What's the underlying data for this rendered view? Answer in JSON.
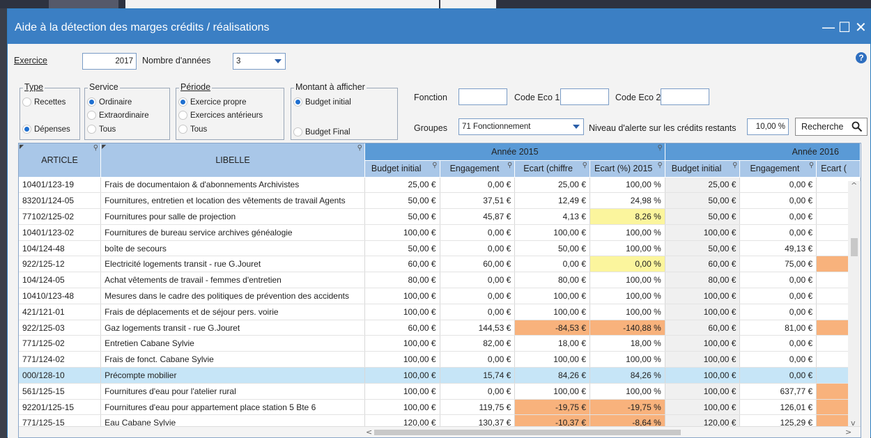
{
  "window": {
    "title": "Aide à la détection des marges crédits / réalisations",
    "minimize": "—",
    "maximize": "☐",
    "close": "✕"
  },
  "filters": {
    "exercice_label": "Exercice",
    "exercice_value": "2017",
    "nombre_annees_label": "Nombre d'années",
    "nombre_annees_value": "3",
    "type_label": "Type",
    "type_options": [
      "Recettes",
      "Dépenses"
    ],
    "type_selected": "Dépenses",
    "service_label": "Service",
    "service_options": [
      "Ordinaire",
      "Extraordinaire",
      "Tous"
    ],
    "service_selected": "Ordinaire",
    "periode_label": "Période",
    "periode_options": [
      "Exercice propre",
      "Exercices antérieurs",
      "Tous"
    ],
    "periode_selected": "Exercice propre",
    "montant_label": "Montant à afficher",
    "montant_options": [
      "Budget initial",
      "Budget Final"
    ],
    "montant_selected": "Budget initial",
    "fonction_label": "Fonction",
    "fonction_value": "",
    "code_eco1_label": "Code Eco 1",
    "code_eco1_value": "",
    "code_eco2_label": "Code Eco 2",
    "code_eco2_value": "",
    "groupes_label": "Groupes",
    "groupes_value": "71 Fonctionnement",
    "alerte_label": "Niveau d'alerte sur les crédits restants",
    "alerte_value": "10,00 %",
    "search_button": "Recherche",
    "help_icon": "?"
  },
  "table": {
    "col_article": "ARTICLE",
    "col_libelle": "LIBELLE",
    "year1": "Année 2015",
    "year2": "Année 2016",
    "sub_budget": "Budget initial",
    "sub_engagement": "Engagement",
    "sub_ecart_chiffre": "Ecart (chiffre",
    "sub_ecart_pct": "Ecart (%) 2015",
    "sub_ecart2": "Ecart (",
    "rows": [
      {
        "article": "10401/123-19",
        "libelle": "Frais de documentaion & d'abonnements Archivistes",
        "b15": "25,00 €",
        "e15": "0,00 €",
        "ec15": "25,00 €",
        "ep15": "100,00 %",
        "b16": "25,00 €",
        "e16": "0,00 €",
        "hl": "",
        "hl2": ""
      },
      {
        "article": "83201/124-05",
        "libelle": "Fournitures, entretien et location des vêtements de travail Agents",
        "b15": "50,00 €",
        "e15": "37,51 €",
        "ec15": "12,49 €",
        "ep15": "24,98 %",
        "b16": "50,00 €",
        "e16": "0,00 €",
        "hl": "",
        "hl2": ""
      },
      {
        "article": "77102/125-02",
        "libelle": "Fournitures pour salle de projection",
        "b15": "50,00 €",
        "e15": "45,87 €",
        "ec15": "4,13 €",
        "ep15": "8,26 %",
        "b16": "50,00 €",
        "e16": "0,00 €",
        "hl": "yellow",
        "hl2": ""
      },
      {
        "article": "10401/123-02",
        "libelle": "Fournitures de bureau service archives généalogie",
        "b15": "100,00 €",
        "e15": "0,00 €",
        "ec15": "100,00 €",
        "ep15": "100,00 %",
        "b16": "100,00 €",
        "e16": "0,00 €",
        "hl": "",
        "hl2": ""
      },
      {
        "article": "104/124-48",
        "libelle": "boîte de secours",
        "b15": "50,00 €",
        "e15": "0,00 €",
        "ec15": "50,00 €",
        "ep15": "100,00 %",
        "b16": "50,00 €",
        "e16": "49,13 €",
        "hl": "",
        "hl2": ""
      },
      {
        "article": "922/125-12",
        "libelle": "Electricité logements transit - rue G.Jouret",
        "b15": "60,00 €",
        "e15": "60,00 €",
        "ec15": "0,00 €",
        "ep15": "0,00 %",
        "b16": "60,00 €",
        "e16": "75,00 €",
        "hl": "yellow",
        "hl2": "orange"
      },
      {
        "article": "104/124-05",
        "libelle": "Achat vêtements de travail - femmes d'entretien",
        "b15": "80,00 €",
        "e15": "0,00 €",
        "ec15": "80,00 €",
        "ep15": "100,00 %",
        "b16": "80,00 €",
        "e16": "0,00 €",
        "hl": "",
        "hl2": ""
      },
      {
        "article": "10410/123-48",
        "libelle": "Mesures dans le cadre des politiques de prévention des accidents",
        "b15": "100,00 €",
        "e15": "0,00 €",
        "ec15": "100,00 €",
        "ep15": "100,00 %",
        "b16": "100,00 €",
        "e16": "0,00 €",
        "hl": "",
        "hl2": ""
      },
      {
        "article": "421/121-01",
        "libelle": "Frais de déplacements et de séjour pers. voirie",
        "b15": "100,00 €",
        "e15": "0,00 €",
        "ec15": "100,00 €",
        "ep15": "100,00 %",
        "b16": "100,00 €",
        "e16": "0,00 €",
        "hl": "",
        "hl2": ""
      },
      {
        "article": "922/125-03",
        "libelle": "Gaz logements transit - rue G.Jouret",
        "b15": "60,00 €",
        "e15": "144,53 €",
        "ec15": "-84,53 €",
        "ep15": "-140,88 %",
        "b16": "60,00 €",
        "e16": "81,00 €",
        "hl": "orange",
        "hl2": "orange"
      },
      {
        "article": "771/125-02",
        "libelle": "Entretien Cabane Sylvie",
        "b15": "100,00 €",
        "e15": "82,00 €",
        "ec15": "18,00 €",
        "ep15": "18,00 %",
        "b16": "100,00 €",
        "e16": "0,00 €",
        "hl": "",
        "hl2": ""
      },
      {
        "article": "771/124-02",
        "libelle": "Frais de fonct. Cabane Sylvie",
        "b15": "100,00 €",
        "e15": "0,00 €",
        "ec15": "100,00 €",
        "ep15": "100,00 %",
        "b16": "100,00 €",
        "e16": "0,00 €",
        "hl": "",
        "hl2": ""
      },
      {
        "article": "000/128-10",
        "libelle": "Précompte mobilier",
        "b15": "100,00 €",
        "e15": "15,74 €",
        "ec15": "84,26 €",
        "ep15": "84,26 %",
        "b16": "100,00 €",
        "e16": "0,00 €",
        "hl": "",
        "hl2": "",
        "selected": true
      },
      {
        "article": "561/125-15",
        "libelle": "Fournitures d'eau pour l'atelier rural",
        "b15": "100,00 €",
        "e15": "0,00 €",
        "ec15": "100,00 €",
        "ep15": "100,00 %",
        "b16": "100,00 €",
        "e16": "637,77 €",
        "hl": "",
        "hl2": "orange"
      },
      {
        "article": "92201/125-15",
        "libelle": "Fournitures d'eau pour appartement place station 5 Bte 6",
        "b15": "100,00 €",
        "e15": "119,75 €",
        "ec15": "-19,75 €",
        "ep15": "-19,75 %",
        "b16": "100,00 €",
        "e16": "126,01 €",
        "hl": "orange",
        "hl2": "orange"
      },
      {
        "article": "771/125-15",
        "libelle": "Eau Cabane Sylvie",
        "b15": "120,00 €",
        "e15": "130,37 €",
        "ec15": "-10,37 €",
        "ep15": "-8,64 %",
        "b16": "120,00 €",
        "e16": "125,29 €",
        "hl": "orange",
        "hl2": "orange"
      }
    ]
  },
  "icons": {
    "help": "help-icon",
    "search": "search-icon",
    "filter": "filter-magnifier-icon",
    "dropdown": "chevron-down-icon"
  },
  "colors": {
    "titlebar": "#3b7fc4",
    "header": "#a9c7e8",
    "header_year": "#5a9ad6",
    "selected_row": "#c6e5f7",
    "warn_yellow": "#fbf59d",
    "warn_orange": "#f8b27c"
  }
}
